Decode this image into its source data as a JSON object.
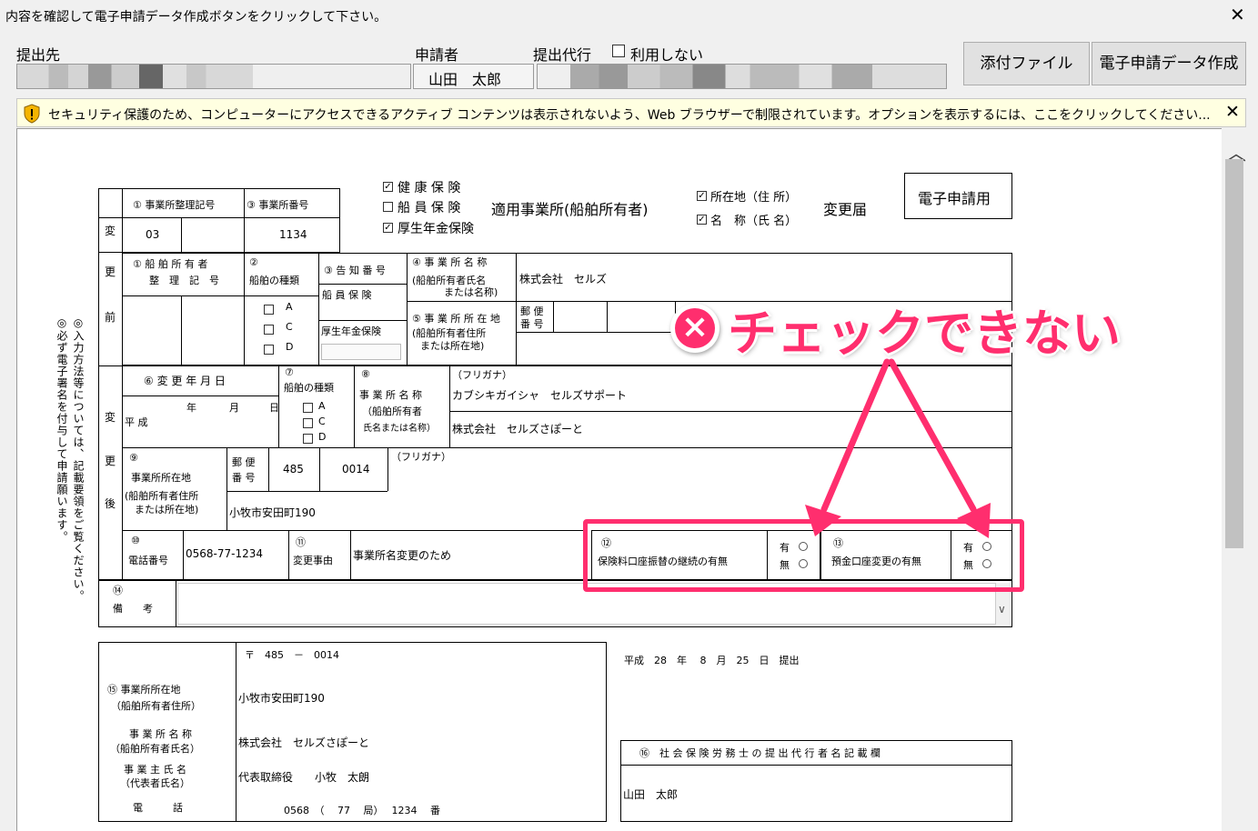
{
  "window": {
    "instruction": "内容を確認して電子申請データ作成ボタンをクリックして下さい。",
    "close_glyph": "✕"
  },
  "toolbar": {
    "submit_to_label": "提出先",
    "applicant_label": "申請者",
    "applicant_value": "山田　太郎",
    "proxy_label": "提出代行",
    "proxy_checkbox_label": "利用しない",
    "attach_button": "添付ファイル",
    "create_button": "電子申請データ作成"
  },
  "infobar": {
    "message": "セキュリティ保護のため、コンピューターにアクセスできるアクティブ コンテンツは表示されないよう、Web ブラウザーで制限されています。オプションを表示するには、ここをクリックしてください...",
    "close_glyph": "✕"
  },
  "form": {
    "insurance": {
      "health": "健 康 保 険",
      "seaman": "船 員 保 険",
      "pension": "厚生年金保険",
      "title_mid": "適用事業所(船舶所有者)",
      "location": "所在地（住 所）",
      "name": "名　称（氏 名）",
      "title_end": "変更届",
      "electronic": "電子申請用"
    },
    "before": {
      "side_chars": [
        "変",
        "更",
        "前"
      ],
      "office_ref_label": "① 事業所整理記号",
      "office_num_label": "③ 事業所番号",
      "office_ref_value": "03",
      "office_num_value": "1134",
      "ship_owner_label_1": "① 船 舶 所 有 者",
      "ship_owner_label_2": "整　理　記　号",
      "ship_type_label_1": "②",
      "ship_type_label_2": "船舶の種類",
      "ship_types": [
        "A",
        "C",
        "D"
      ],
      "notice_label": "③ 告 知 番 号",
      "seaman_ins": "船 員 保 険",
      "pension_ins": "厚生年金保険",
      "office_name_label_1": "④ 事 業 所 名 称",
      "office_name_label_2": "(船舶所有者氏名",
      "office_name_label_3": "または名称)",
      "office_name_value": "株式会社　セルズ",
      "address_label_1": "⑤ 事 業 所 所 在 地",
      "address_label_2": "(船舶所有者住所",
      "address_label_3": "または所在地)",
      "postal_label_1": "郵 便",
      "postal_label_2": "番 号"
    },
    "after": {
      "side_chars": [
        "変",
        "更",
        "後"
      ],
      "change_date_label": "⑥ 変 更 年 月 日",
      "era": "平 成",
      "year": "年",
      "month": "月",
      "day": "日",
      "ship_type_label_1": "⑦",
      "ship_type_label_2": "船舶の種類",
      "ship_types": [
        "A",
        "C",
        "D"
      ],
      "name_label_1": "⑧",
      "name_label_2": "事 業 所 名 称",
      "name_label_3": "（船舶所有者",
      "name_label_4": "氏名または名称）",
      "furigana": "（フリガナ）",
      "name_kana": "カブシキガイシャ　セルズサポート",
      "name_value": "株式会社　セルズさぽーと",
      "address_label_1": "⑨",
      "address_label_2": "事業所所在地",
      "address_label_3": "(船舶所有者住所",
      "address_label_4": "または所在地)",
      "postal_label_1": "郵 便",
      "postal_label_2": "番 号",
      "postal_1": "485",
      "postal_2": "0014",
      "furigana2": "（フリガナ）",
      "address_value": "小牧市安田町190",
      "phone_label_1": "⑩",
      "phone_label_2": "電話番号",
      "phone_value": "0568-77-1234",
      "reason_label_1": "⑪",
      "reason_label_2": "変更事由",
      "reason_value": "事業所名変更のため",
      "q12_num": "⑫",
      "q12_label": "保険料口座振替の継続の有無",
      "q13_num": "⑬",
      "q13_label": "預金口座変更の有無",
      "yes": "有",
      "no": "無"
    },
    "remarks_label_1": "⑭",
    "remarks_label_2": "備　　考",
    "left_note_1": "◎入力方法等については、記載要領をご覧ください。",
    "left_note_2": "◎必ず電子署名を付与して申請願います。",
    "submitter": {
      "postal": "〒　485　－　0014",
      "addr_label_1": "⑮ 事業所所在地",
      "addr_label_2": "（船舶所有者住所）",
      "addr_value": "小牧市安田町190",
      "name_label_1": "事 業 所 名 称",
      "name_label_2": "（船舶所有者氏名）",
      "name_value": "株式会社　セルズさぽーと",
      "owner_label_1": "事 業 主 氏 名",
      "owner_label_2": "（代表者氏名）",
      "owner_value": "代表取締役　　小牧　太朗",
      "phone_label": "電　　　話",
      "phone_value": "0568　（　 77　 局）　 1234　 番",
      "date": "平成　28　年　 8　月　25　日　提出",
      "agent_label": "⑯　社 会 保 険 労 務 士 の 提 出 代 行 者 名 記 載 欄",
      "agent_value": "山田　太郎"
    }
  },
  "annotation": {
    "x_glyph": "×",
    "text": "チェックできない",
    "color": "#ff2e6e"
  }
}
